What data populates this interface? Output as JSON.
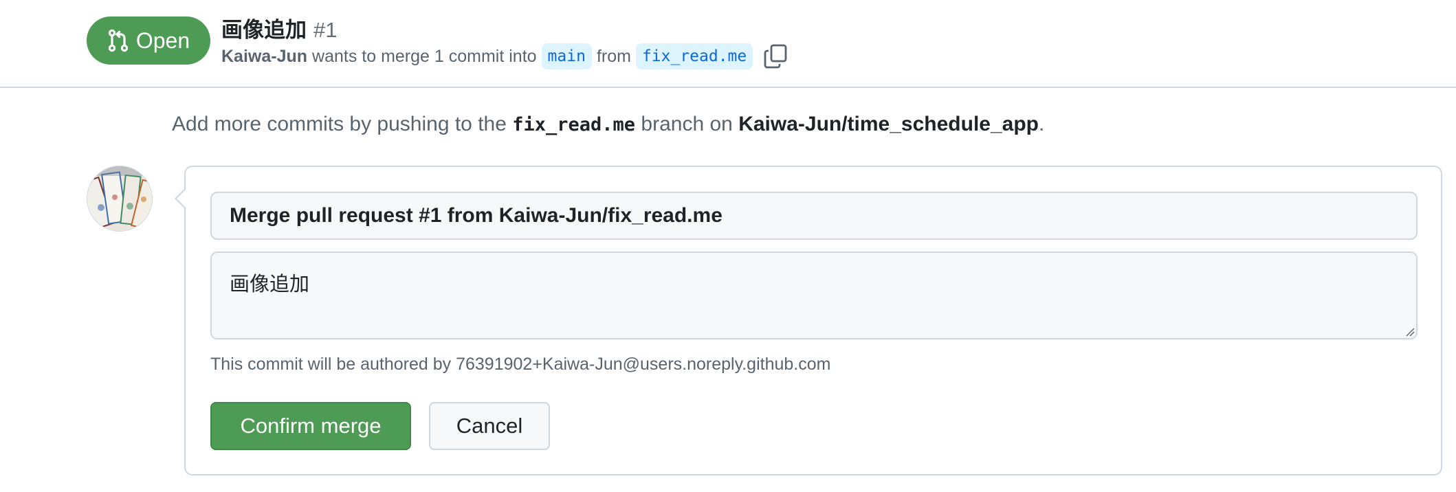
{
  "pr": {
    "state": "Open",
    "state_icon": "git-pull-request-icon",
    "title": "画像追加",
    "number": "#1",
    "author": "Kaiwa-Jun",
    "meta_text_1": "wants to merge 1 commit into",
    "base_branch": "main",
    "meta_text_2": "from",
    "head_branch": "fix_read.me",
    "copy_icon": "copy-icon"
  },
  "hint": {
    "prefix": "Add more commits by pushing to the",
    "branch": "fix_read.me",
    "middle": "branch on",
    "repo": "Kaiwa-Jun/time_schedule_app",
    "suffix": "."
  },
  "merge_form": {
    "commit_title_value": "Merge pull request #1 from Kaiwa-Jun/fix_read.me",
    "commit_body_value": "画像追加",
    "author_note": "This commit will be authored by 76391902+Kaiwa-Jun@users.noreply.github.com",
    "confirm_label": "Confirm merge",
    "cancel_label": "Cancel"
  },
  "colors": {
    "open_green": "#4d9b54",
    "branch_bg": "#ddf4ff",
    "branch_text": "#0969da",
    "border": "#d0d7de",
    "muted_text": "#59636e"
  }
}
